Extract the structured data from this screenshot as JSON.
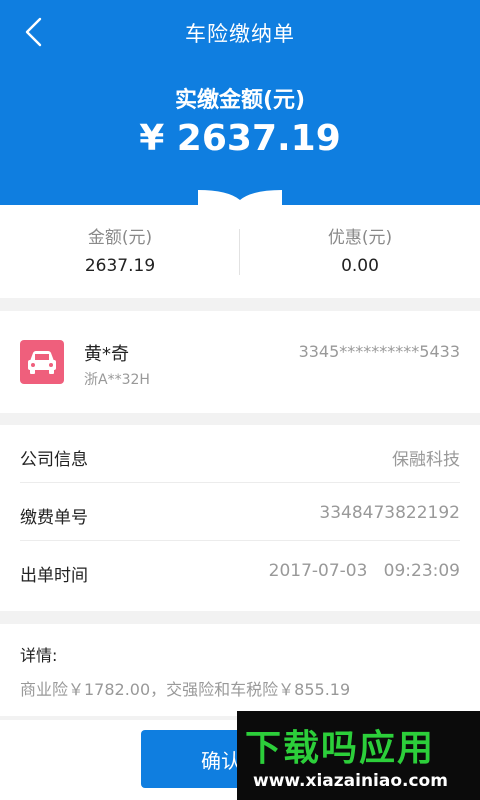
{
  "header": {
    "title": "车险缴纳单",
    "amount_label": "实缴金额(元)",
    "amount": "¥ 2637.19",
    "color": "#0f7ee0"
  },
  "summary": {
    "amount_label": "金额(元)",
    "amount_value": "2637.19",
    "discount_label": "优惠(元)",
    "discount_value": "0.00"
  },
  "owner": {
    "icon": "car-icon",
    "icon_color": "#ef5f7c",
    "name": "黄*奇",
    "plate": "浙A**32H",
    "id_number": "3345**********5433"
  },
  "info": {
    "rows": [
      {
        "key": "公司信息",
        "value": "保融科技"
      },
      {
        "key": "缴费单号",
        "value": "3348473822192"
      },
      {
        "key": "出单时间",
        "value": "2017-07-03   09:23:09"
      }
    ]
  },
  "details": {
    "label": "详情:",
    "text": "商业险￥1782.00，交强险和车税险￥855.19"
  },
  "footer": {
    "confirm_label": "确认"
  },
  "watermark": {
    "logo": "下载吗应用",
    "url": "www.xiazainiao.com"
  }
}
